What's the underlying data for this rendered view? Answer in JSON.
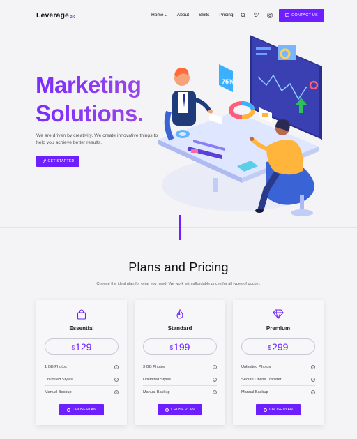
{
  "header": {
    "logo": "Leverage",
    "logo_version": "2.0",
    "nav": [
      {
        "label": "Home",
        "has_dropdown": true
      },
      {
        "label": "About"
      },
      {
        "label": "Skills"
      },
      {
        "label": "Pricing"
      }
    ],
    "icons": [
      "search-icon",
      "twitter-icon",
      "instagram-icon"
    ],
    "contact_label": "CONTACT US"
  },
  "hero": {
    "title_line1": "Marketing",
    "title_line2": "Solutions.",
    "text": "We are driven by creativity. We create innovative things to help you achieve better results.",
    "button_label": "GET STARTED",
    "badge_value": "75%"
  },
  "pricing": {
    "title": "Plans and Pricing",
    "subtitle": "Choose the ideal plan for what you need. We work with affordable prices for all types of pocket.",
    "plans": [
      {
        "name": "Essential",
        "currency": "$",
        "price": "129",
        "icon": "shopping-bag-icon",
        "features": [
          "1 GB Photos",
          "Unlimited Styles",
          "Manual Backup"
        ],
        "feature_status": [
          "check",
          "check",
          "cross"
        ],
        "button": "CHOSE PLAN"
      },
      {
        "name": "Standard",
        "currency": "$",
        "price": "199",
        "icon": "fire-icon",
        "features": [
          "3 GB Photos",
          "Unlimited Styles",
          "Manual Backup"
        ],
        "feature_status": [
          "check",
          "check",
          "check"
        ],
        "button": "CHOSE PLAN"
      },
      {
        "name": "Premium",
        "currency": "$",
        "price": "299",
        "icon": "diamond-icon",
        "features": [
          "Unlimited Photos",
          "Secure Online Transfer",
          "Manual Backup"
        ],
        "feature_status": [
          "check",
          "check",
          "check"
        ],
        "button": "CHOSE PLAN"
      }
    ]
  },
  "colors": {
    "accent": "#6d1fff",
    "background": "#f4f4f6"
  }
}
